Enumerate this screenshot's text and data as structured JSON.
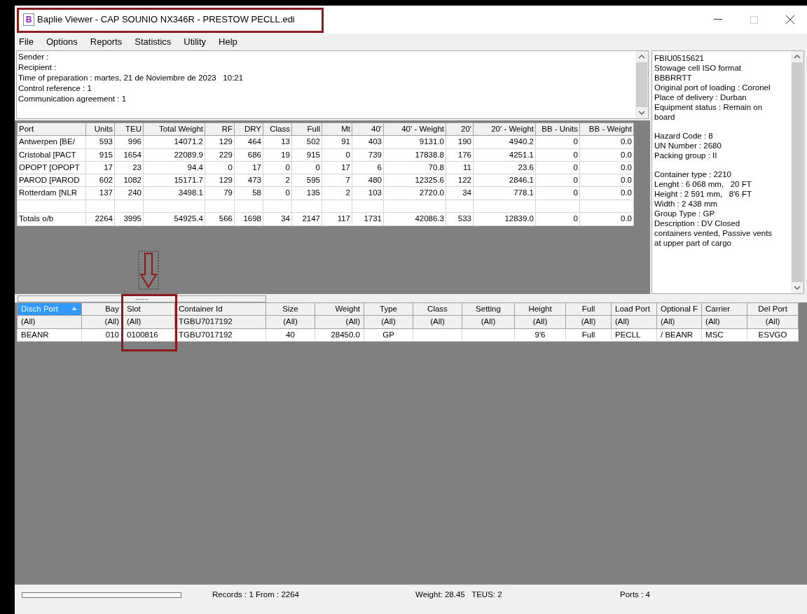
{
  "window": {
    "title": "Baplie Viewer - CAP SOUNIO NX346R - PRESTOW PECLL.edi",
    "icon_letter": "B"
  },
  "menu": [
    "File",
    "Options",
    "Reports",
    "Statistics",
    "Utility",
    "Help"
  ],
  "header_lines": [
    "Sender :",
    "Recipient :",
    "Time of preparation : martes, 21 de Noviembre de 2023   10:21",
    "Control reference : 1",
    "Communication agreement : 1"
  ],
  "summary": {
    "columns": [
      "Port",
      "Units",
      "TEU",
      "Total Weight",
      "RF",
      "DRY",
      "Class",
      "Full",
      "Mt",
      "40'",
      "40' - Weight",
      "20'",
      "20' - Weight",
      "BB - Units",
      "BB - Weight"
    ],
    "rows": [
      [
        "Antwerpen [BE/",
        "593",
        "996",
        "14071.2",
        "129",
        "464",
        "13",
        "502",
        "91",
        "403",
        "9131.0",
        "190",
        "4940.2",
        "0",
        "0.0"
      ],
      [
        "Cristobal [PACT",
        "915",
        "1654",
        "22089.9",
        "229",
        "686",
        "19",
        "915",
        "0",
        "739",
        "17838.8",
        "176",
        "4251.1",
        "0",
        "0.0"
      ],
      [
        "OPOPT [OPOPT",
        "17",
        "23",
        "94.4",
        "0",
        "17",
        "0",
        "0",
        "17",
        "6",
        "70.8",
        "11",
        "23.6",
        "0",
        "0.0"
      ],
      [
        "PAROD [PAROD",
        "602",
        "1082",
        "15171.7",
        "129",
        "473",
        "2",
        "595",
        "7",
        "480",
        "12325.6",
        "122",
        "2846.1",
        "0",
        "0.0"
      ],
      [
        "Rotterdam [NLR",
        "137",
        "240",
        "3498.1",
        "79",
        "58",
        "0",
        "135",
        "2",
        "103",
        "2720.0",
        "34",
        "778.1",
        "0",
        "0.0"
      ]
    ],
    "totals": [
      "Totals o/b",
      "2264",
      "3995",
      "54925.4",
      "566",
      "1698",
      "34",
      "2147",
      "117",
      "1731",
      "42086.3",
      "533",
      "12839.0",
      "0",
      "0.0"
    ]
  },
  "details": [
    [
      "FBIU0515621",
      "Stowage cell ISO format",
      "BBBRRTT",
      "Original port of loading : Coronel",
      "Place of delivery : Durban",
      "Equipment status : Remain on board"
    ],
    [
      "Hazard Code : 8",
      "UN Number : 2680",
      "Packing group : II"
    ],
    [
      "Container type : 2210",
      "Lenght : 6 068 mm,   20 FT",
      "Height : 2 591 mm,   8'6 FT",
      "Width : 2 438 mm",
      "Group Type : GP",
      "Description : DV Closed containers vented, Passive vents at upper part of cargo"
    ]
  ],
  "splitter_label": "-------",
  "grid": {
    "columns": [
      {
        "label": "Disch Port",
        "selected": true
      },
      {
        "label": "Bay",
        "selected": false
      },
      {
        "label": "Slot",
        "selected": false
      },
      {
        "label": "Container Id",
        "selected": false
      },
      {
        "label": "Size",
        "selected": false
      },
      {
        "label": "Weight",
        "selected": false
      },
      {
        "label": "Type",
        "selected": false
      },
      {
        "label": "Class",
        "selected": false
      },
      {
        "label": "Setting",
        "selected": false
      },
      {
        "label": "Height",
        "selected": false
      },
      {
        "label": "Full",
        "selected": false
      },
      {
        "label": "Load Port",
        "selected": false
      },
      {
        "label": "Optional F",
        "selected": false
      },
      {
        "label": "Carrier",
        "selected": false
      },
      {
        "label": "Del Port",
        "selected": false
      }
    ],
    "filters": [
      "(All)",
      "(All)",
      "(All)",
      "TGBU7017192",
      "(All)",
      "(All)",
      "(All)",
      "(All)",
      "(All)",
      "(All)",
      "(All)",
      "(All)",
      "(All)",
      "(All)",
      "(All)"
    ],
    "rows": [
      [
        "BEANR",
        "010",
        "0100816",
        "TGBU7017192",
        "40",
        "28450.0",
        "GP",
        "",
        "",
        "9'6",
        "Full",
        "PECLL",
        "/ BEANR",
        "MSC",
        "ESVGO"
      ]
    ]
  },
  "status_bar": {
    "records": "Records : 1 From : 2264",
    "weight": "Weight: 28.45   TEUS: 2",
    "ports": "Ports : 4"
  }
}
